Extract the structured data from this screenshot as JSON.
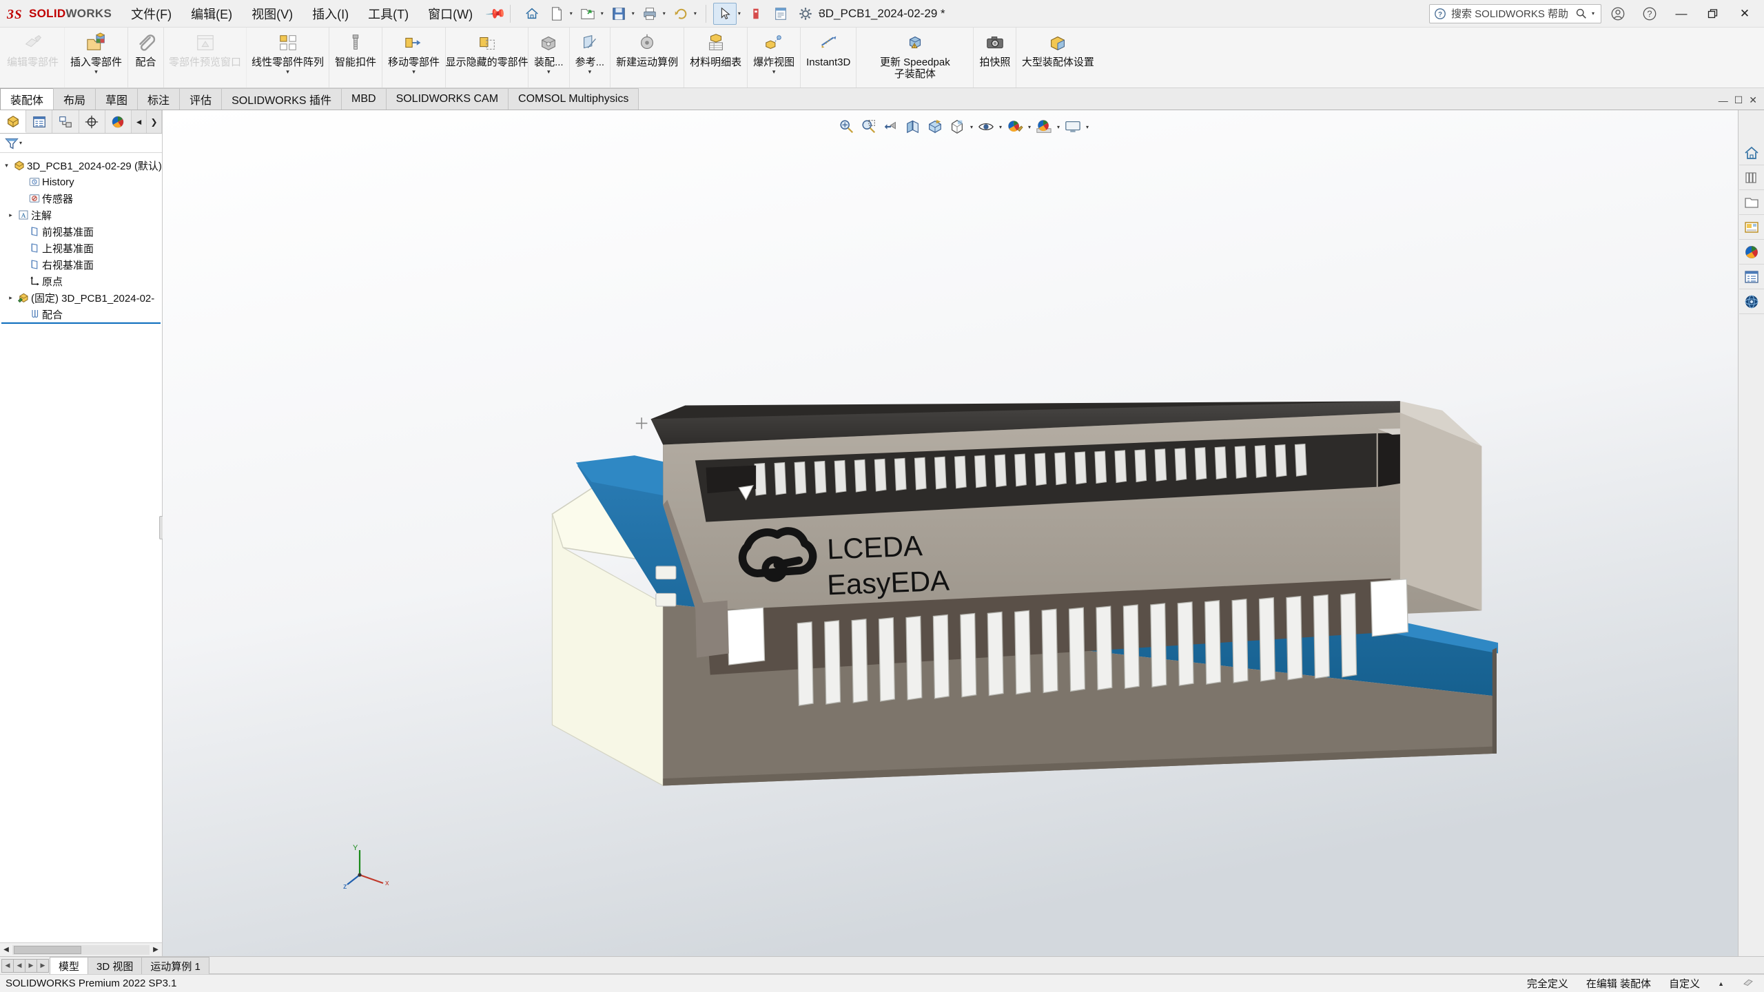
{
  "app": {
    "brand_ds": "ℳS",
    "brand_solid": "SOLID",
    "brand_works": "WORKS",
    "title": "3D_PCB1_2024-02-29 *",
    "version_status": "SOLIDWORKS Premium 2022 SP3.1",
    "accent": "#0a6cbd",
    "brand_color": "#c00000"
  },
  "menu": {
    "items": [
      {
        "label": "文件(F)",
        "name": "menu-file"
      },
      {
        "label": "编辑(E)",
        "name": "menu-edit"
      },
      {
        "label": "视图(V)",
        "name": "menu-view"
      },
      {
        "label": "插入(I)",
        "name": "menu-insert"
      },
      {
        "label": "工具(T)",
        "name": "menu-tools"
      },
      {
        "label": "窗口(W)",
        "name": "menu-window"
      }
    ],
    "pin_icon": "pin-icon"
  },
  "quick_access": [
    {
      "name": "home-icon",
      "icon": "home"
    },
    {
      "name": "new-document-icon",
      "icon": "new-doc",
      "caret": true
    },
    {
      "name": "open-document-icon",
      "icon": "open",
      "caret": true
    },
    {
      "name": "save-icon",
      "icon": "save",
      "caret": true
    },
    {
      "name": "print-icon",
      "icon": "print",
      "caret": true
    },
    {
      "name": "undo-icon",
      "icon": "undo",
      "caret": true
    },
    {
      "name": "select-icon",
      "icon": "cursor",
      "caret": true
    },
    {
      "name": "rebuild-icon",
      "icon": "rebuild"
    },
    {
      "name": "file-properties-icon",
      "icon": "props"
    },
    {
      "name": "options-icon",
      "icon": "gear"
    }
  ],
  "search": {
    "placeholder": "搜索 SOLIDWORKS 帮助",
    "icon": "search-icon",
    "help_badge": "question-icon"
  },
  "window_controls": {
    "account": "account-icon",
    "help": "help-icon",
    "minimize": "—",
    "restore": "❐",
    "close": "✕"
  },
  "commandmanager": {
    "commands": [
      {
        "label": "编辑零部件",
        "name": "cmd-edit-component",
        "icon": "edit-component",
        "disabled": true,
        "caret": false
      },
      {
        "label": "插入零部件",
        "name": "cmd-insert-component",
        "icon": "insert-component",
        "disabled": false,
        "caret": true
      },
      {
        "label": "配合",
        "name": "cmd-mate",
        "icon": "mate",
        "disabled": false,
        "caret": false
      },
      {
        "label": "零部件预览窗口",
        "name": "cmd-component-preview-window",
        "icon": "preview-window",
        "disabled": true,
        "caret": false
      },
      {
        "label": "线性零部件阵列",
        "name": "cmd-linear-component-pattern",
        "icon": "linear-pattern",
        "disabled": false,
        "caret": true
      },
      {
        "label": "智能扣件",
        "name": "cmd-smart-fasteners",
        "icon": "smart-fastener",
        "disabled": false,
        "caret": false
      },
      {
        "label": "移动零部件",
        "name": "cmd-move-component",
        "icon": "move-component",
        "disabled": false,
        "caret": true
      },
      {
        "label": "显示隐藏的零部件",
        "name": "cmd-show-hidden-components",
        "icon": "show-hidden",
        "disabled": false,
        "caret": false
      },
      {
        "label": "装配...",
        "name": "cmd-assembly-features",
        "icon": "assembly-feature",
        "disabled": false,
        "caret": true
      },
      {
        "label": "参考...",
        "name": "cmd-reference-geometry",
        "icon": "reference-geometry",
        "disabled": false,
        "caret": true
      },
      {
        "label": "新建运动算例",
        "name": "cmd-new-motion-study",
        "icon": "motion-study",
        "disabled": false,
        "caret": false
      },
      {
        "label": "材料明细表",
        "name": "cmd-bill-of-materials",
        "icon": "bom",
        "disabled": false,
        "caret": false
      },
      {
        "label": "爆炸视图",
        "name": "cmd-exploded-view",
        "icon": "exploded-view",
        "disabled": false,
        "caret": true
      },
      {
        "label": "Instant3D",
        "name": "cmd-instant3d",
        "icon": "instant3d",
        "disabled": false,
        "caret": false
      },
      {
        "label": "更新 Speedpak 子装配体",
        "name": "cmd-update-speedpak",
        "icon": "speedpak",
        "disabled": false,
        "caret": false
      },
      {
        "label": "拍快照",
        "name": "cmd-take-snapshot",
        "icon": "snapshot",
        "disabled": false,
        "caret": false
      },
      {
        "label": "大型装配体设置",
        "name": "cmd-large-assembly-settings",
        "icon": "large-assembly",
        "disabled": false,
        "caret": false
      }
    ]
  },
  "ribbon_tabs": {
    "active_index": 0,
    "items": [
      {
        "label": "装配体",
        "name": "tab-assembly"
      },
      {
        "label": "布局",
        "name": "tab-layout"
      },
      {
        "label": "草图",
        "name": "tab-sketch"
      },
      {
        "label": "标注",
        "name": "tab-markup"
      },
      {
        "label": "评估",
        "name": "tab-evaluate"
      },
      {
        "label": "SOLIDWORKS 插件",
        "name": "tab-solidworks-addins"
      },
      {
        "label": "MBD",
        "name": "tab-mbd"
      },
      {
        "label": "SOLIDWORKS CAM",
        "name": "tab-solidworks-cam"
      },
      {
        "label": "COMSOL Multiphysics",
        "name": "tab-comsol-multiphysics"
      }
    ],
    "window_icons": [
      "minimize-icon",
      "restore-icon",
      "close-icon"
    ]
  },
  "feature_manager": {
    "panel_tabs": [
      {
        "name": "tab-featuremanager-tree",
        "icon": "feature-tree"
      },
      {
        "name": "tab-property-manager",
        "icon": "property-manager"
      },
      {
        "name": "tab-configuration-manager",
        "icon": "configuration-manager"
      },
      {
        "name": "tab-dimxpert-manager",
        "icon": "dimxpert"
      },
      {
        "name": "tab-display-manager",
        "icon": "display-manager"
      }
    ],
    "nav_prev": "◄",
    "nav_next": "❯",
    "filter_icon": "filter-icon",
    "tree": [
      {
        "label": "3D_PCB1_2024-02-29 (默认)",
        "name": "tree-node-root",
        "icon": "assembly-icon",
        "indent": 0,
        "expandable": true,
        "expanded": true
      },
      {
        "label": "History",
        "name": "tree-node-history",
        "icon": "history-icon",
        "indent": 1,
        "expandable": false
      },
      {
        "label": "传感器",
        "name": "tree-node-sensors",
        "icon": "sensor-icon",
        "indent": 1,
        "expandable": false
      },
      {
        "label": "注解",
        "name": "tree-node-annotations",
        "icon": "annotation-icon",
        "indent": 1,
        "expandable": true
      },
      {
        "label": "前视基准面",
        "name": "tree-node-front-plane",
        "icon": "plane-icon",
        "indent": 1,
        "expandable": false
      },
      {
        "label": "上视基准面",
        "name": "tree-node-top-plane",
        "icon": "plane-icon",
        "indent": 1,
        "expandable": false
      },
      {
        "label": "右视基准面",
        "name": "tree-node-right-plane",
        "icon": "plane-icon",
        "indent": 1,
        "expandable": false
      },
      {
        "label": "原点",
        "name": "tree-node-origin",
        "icon": "origin-icon",
        "indent": 1,
        "expandable": false
      },
      {
        "label": "(固定) 3D_PCB1_2024-02-",
        "name": "tree-node-fixed-component",
        "icon": "component-icon",
        "indent": 1,
        "expandable": true
      },
      {
        "label": "配合",
        "name": "tree-node-mates",
        "icon": "mates-icon",
        "indent": 1,
        "expandable": false
      }
    ]
  },
  "heads_up_toolbar": [
    {
      "name": "zoom-to-fit-icon",
      "icon": "zoom-fit",
      "caret": false
    },
    {
      "name": "zoom-to-area-icon",
      "icon": "zoom-area",
      "caret": false
    },
    {
      "name": "previous-view-icon",
      "icon": "prev-view",
      "caret": false
    },
    {
      "name": "section-view-icon",
      "icon": "section-view",
      "caret": false
    },
    {
      "name": "view-orientation-icon",
      "icon": "view-orientation",
      "caret": false
    },
    {
      "name": "display-style-icon",
      "icon": "display-style",
      "caret": true
    },
    {
      "name": "hide-show-items-icon",
      "icon": "hide-show",
      "caret": true
    },
    {
      "name": "edit-appearance-icon",
      "icon": "appearance",
      "caret": true
    },
    {
      "name": "apply-scene-icon",
      "icon": "scene",
      "caret": true
    },
    {
      "name": "view-settings-icon",
      "icon": "view-settings",
      "caret": true
    }
  ],
  "task_pane": [
    {
      "name": "task-pane-resources",
      "icon": "home-house"
    },
    {
      "name": "task-pane-design-library",
      "icon": "library-books"
    },
    {
      "name": "task-pane-file-explorer",
      "icon": "folder"
    },
    {
      "name": "task-pane-view-palette",
      "icon": "view-palette"
    },
    {
      "name": "task-pane-appearances-scenes",
      "icon": "appearance-ball"
    },
    {
      "name": "task-pane-custom-properties",
      "icon": "custom-properties"
    },
    {
      "name": "task-pane-3dexperience",
      "icon": "3dexperience-globe"
    }
  ],
  "model_view": {
    "logo_line1": "LCEDA",
    "logo_line2": "EasyEDA",
    "triad_labels": {
      "x": "x",
      "y": "Y",
      "z": "z"
    },
    "colors": {
      "connector_body": "#a39c93",
      "connector_top": "#3a3a3a",
      "pcb_blue": "#1b6fa8",
      "pcb_cream": "#fbfbec",
      "pin_metal": "#e8e8e8",
      "shadow": "#7d766c"
    }
  },
  "bottom_tabs": {
    "nav": [
      "⏮",
      "◀",
      "▶",
      "⏭"
    ],
    "items": [
      {
        "label": "模型",
        "name": "bottom-tab-model",
        "active": true
      },
      {
        "label": "3D 视图",
        "name": "bottom-tab-3d-views",
        "active": false
      },
      {
        "label": "运动算例 1",
        "name": "bottom-tab-motion-study-1",
        "active": false
      }
    ]
  },
  "status_bar": {
    "left": "SOLIDWORKS Premium 2022 SP3.1",
    "right": [
      {
        "label": "完全定义",
        "name": "status-fully-defined"
      },
      {
        "label": "在编辑 装配体",
        "name": "status-editing-assembly"
      },
      {
        "label": "自定义",
        "name": "status-custom"
      }
    ]
  }
}
